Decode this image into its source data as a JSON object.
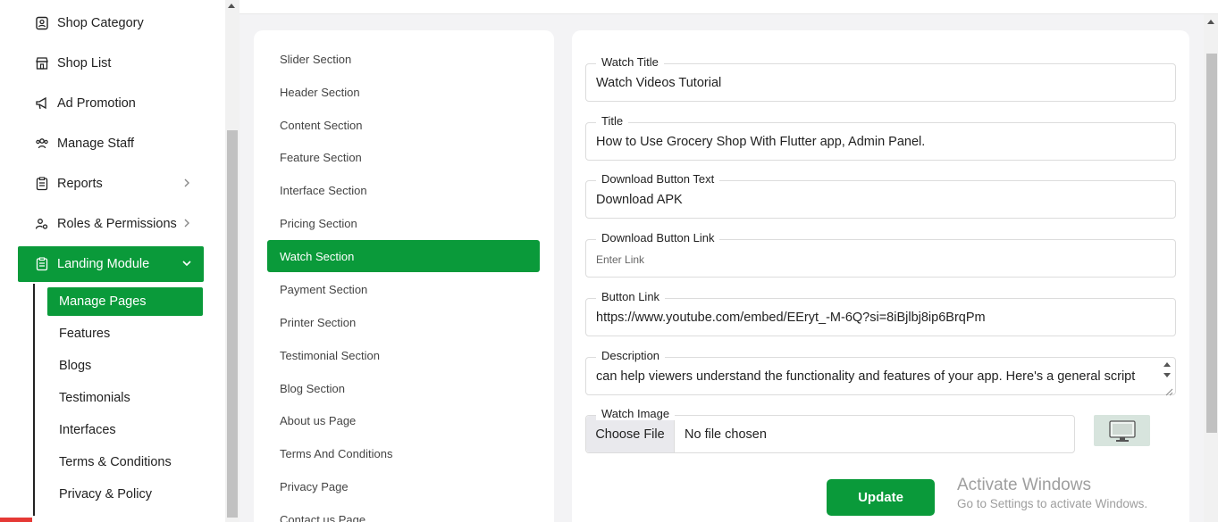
{
  "sidebar": {
    "items": [
      {
        "label": "Shop Category",
        "icon": "clipboard-user-icon"
      },
      {
        "label": "Shop List",
        "icon": "store-icon"
      },
      {
        "label": "Ad Promotion",
        "icon": "megaphone-icon"
      },
      {
        "label": "Manage Staff",
        "icon": "users-icon"
      },
      {
        "label": "Reports",
        "icon": "report-icon"
      },
      {
        "label": "Roles & Permissions",
        "icon": "user-gear-icon"
      },
      {
        "label": "Landing Module",
        "icon": "clipboard-list-icon"
      }
    ],
    "sub_items": [
      {
        "label": "Manage Pages"
      },
      {
        "label": "Features"
      },
      {
        "label": "Blogs"
      },
      {
        "label": "Testimonials"
      },
      {
        "label": "Interfaces"
      },
      {
        "label": "Terms & Conditions"
      },
      {
        "label": "Privacy & Policy"
      }
    ]
  },
  "sections": [
    "Slider Section",
    "Header Section",
    "Content Section",
    "Feature Section",
    "Interface Section",
    "Pricing Section",
    "Watch Section",
    "Payment Section",
    "Printer Section",
    "Testimonial Section",
    "Blog Section",
    "About us Page",
    "Terms And Conditions",
    "Privacy Page",
    "Contact us Page"
  ],
  "form": {
    "watch_title": {
      "label": "Watch Title",
      "value": "Watch Videos Tutorial"
    },
    "title": {
      "label": "Title",
      "value": "How to Use Grocery Shop With Flutter app, Admin Panel."
    },
    "download_text": {
      "label": "Download Button Text",
      "value": "Download APK"
    },
    "download_link": {
      "label": "Download Button Link",
      "placeholder": "Enter Link"
    },
    "button_link": {
      "label": "Button Link",
      "value": "https://www.youtube.com/embed/EEryt_-M-6Q?si=8iBjlbj8ip6BrqPm"
    },
    "description": {
      "label": "Description",
      "value": "can help viewers understand the functionality and features of your app. Here's a general script"
    },
    "watch_image": {
      "label": "Watch Image",
      "choose_label": "Choose File",
      "status": "No file chosen"
    },
    "update_label": "Update"
  },
  "windows": {
    "title": "Activate Windows",
    "subtitle": "Go to Settings to activate Windows."
  },
  "colors": {
    "accent": "#0a9a3a"
  }
}
